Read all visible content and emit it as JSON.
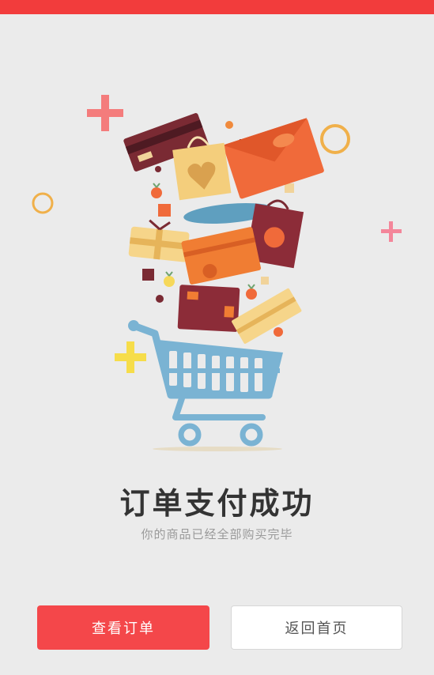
{
  "page": {
    "title": "订单支付成功",
    "subtitle": "你的商品已经全部购买完毕"
  },
  "actions": {
    "view_order_label": "查看订单",
    "back_home_label": "返回首页"
  },
  "colors": {
    "top_bar": "#f23c3c",
    "primary_button": "#f4474a",
    "background": "#ebebeb",
    "cart": "#7ab3d3"
  },
  "icons": {
    "illustration": "shopping-cart-with-gifts-illustration"
  }
}
